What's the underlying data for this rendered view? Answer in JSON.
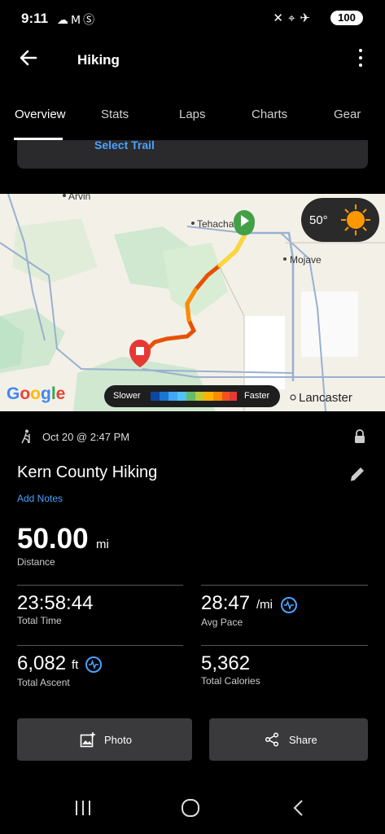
{
  "status": {
    "time": "9:11",
    "battery": "100"
  },
  "appbar": {
    "title": "Hiking"
  },
  "tabs": [
    "Overview",
    "Stats",
    "Laps",
    "Charts",
    "Gear"
  ],
  "trail": {
    "link": "Select Trail"
  },
  "map": {
    "labels": {
      "arvin": "Arvin",
      "tehachapi": "Tehacha",
      "mojave": "Mojave",
      "lancaster": "Lancaster"
    },
    "weather_temp": "50°",
    "legend": {
      "slower": "Slower",
      "faster": "Faster"
    },
    "logo": "Google"
  },
  "activity": {
    "date": "Oct 20 @ 2:47 PM",
    "title": "Kern County Hiking",
    "add_notes": "Add Notes"
  },
  "distance": {
    "value": "50.00",
    "unit": "mi",
    "label": "Distance"
  },
  "stats": {
    "total_time": {
      "value": "23:58:44",
      "label": "Total Time"
    },
    "avg_pace": {
      "value": "28:47",
      "unit": "/mi",
      "label": "Avg Pace"
    },
    "total_ascent": {
      "value": "6,082",
      "unit": "ft",
      "label": "Total Ascent"
    },
    "total_calories": {
      "value": "5,362",
      "label": "Total Calories"
    }
  },
  "actions": {
    "photo": "Photo",
    "share": "Share"
  },
  "colors": {
    "accent": "#4aa3ff",
    "start": "#43a047",
    "end": "#e53935"
  }
}
